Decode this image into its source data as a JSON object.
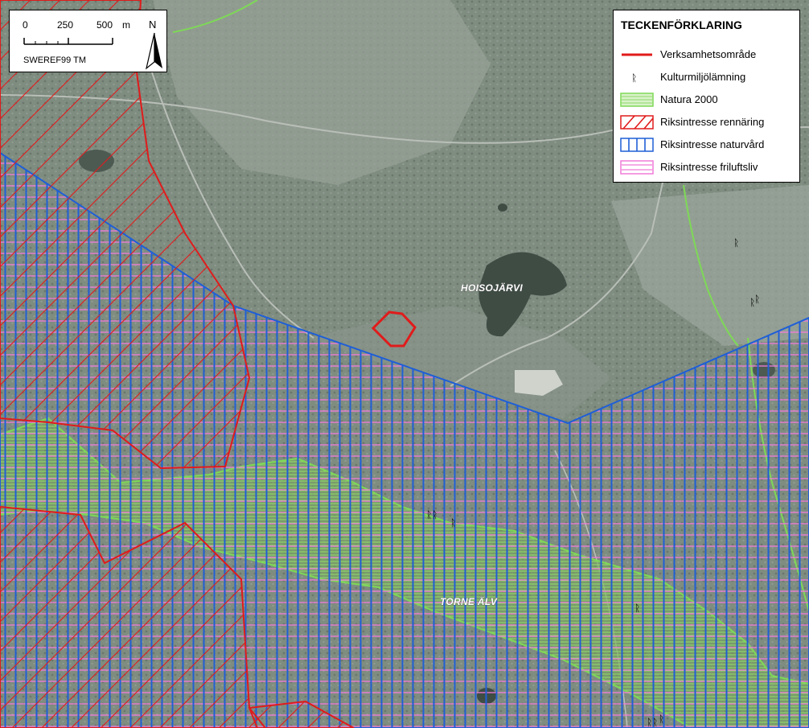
{
  "scalebar": {
    "ticks": [
      "0",
      "250",
      "500"
    ],
    "unit": "m",
    "crs": "SWEREF99 TM"
  },
  "north_arrow": {
    "label": "N",
    "icon": "north-arrow-icon"
  },
  "legend": {
    "title": "TECKENFÖRKLARING",
    "items": [
      {
        "label": "Verksamhetsområde",
        "icon": "red-line-swatch",
        "color": "#e01b1b"
      },
      {
        "label": "Kulturmiljölämning",
        "icon": "heritage-symbol-icon",
        "color": "#000000"
      },
      {
        "label": "Natura 2000",
        "icon": "green-hatch-swatch",
        "color": "#7ed957"
      },
      {
        "label": "Riksintresse rennäring",
        "icon": "red-diagonal-hatch-swatch",
        "color": "#e01b1b"
      },
      {
        "label": "Riksintresse naturvård",
        "icon": "blue-vertical-hatch-swatch",
        "color": "#1f5fd6"
      },
      {
        "label": "Riksintresse friluftsliv",
        "icon": "pink-horizontal-hatch-swatch",
        "color": "#f07bd8"
      }
    ]
  },
  "places": {
    "lake": "HOISOJÄRVI",
    "river": "TORNE ÄLV"
  },
  "heritage_symbol": "ᚱ"
}
